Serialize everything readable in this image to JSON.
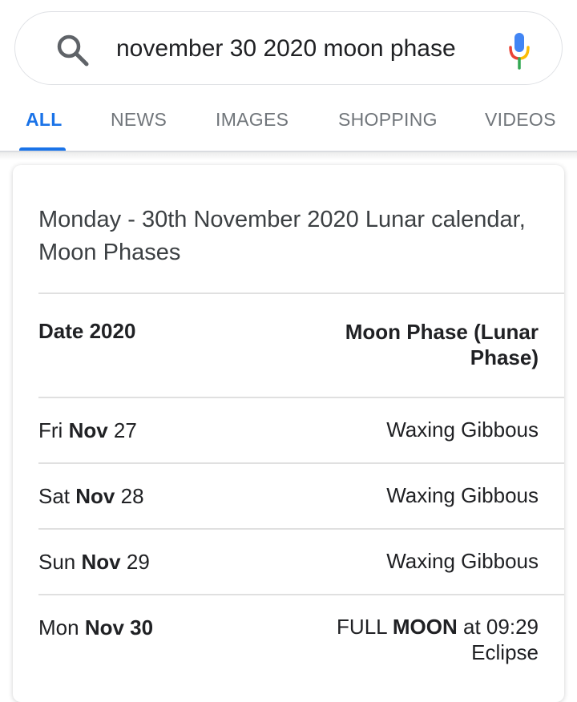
{
  "search": {
    "query": "november 30 2020 moon phase",
    "icon": "search-icon",
    "mic_icon": "mic-icon"
  },
  "tabs": [
    {
      "label": "ALL",
      "active": true
    },
    {
      "label": "NEWS",
      "active": false
    },
    {
      "label": "IMAGES",
      "active": false
    },
    {
      "label": "SHOPPING",
      "active": false
    },
    {
      "label": "VIDEOS",
      "active": false
    }
  ],
  "colors": {
    "accent": "#1a73e8",
    "tab_inactive": "#70757a",
    "text": "#202124"
  },
  "result": {
    "title": "Monday - 30th November 2020 Lunar calendar, Moon Phases",
    "table": {
      "headers": [
        "Date 2020",
        "Moon Phase (Lunar Phase)"
      ],
      "rows": [
        {
          "weekday": "Fri",
          "month": "Nov",
          "day": "27",
          "phase": "Waxing Gibbous"
        },
        {
          "weekday": "Sat",
          "month": "Nov",
          "day": "28",
          "phase": "Waxing Gibbous"
        },
        {
          "weekday": "Sun",
          "month": "Nov",
          "day": "29",
          "phase": "Waxing Gibbous"
        },
        {
          "weekday": "Mon",
          "month": "Nov",
          "day": "30",
          "phase_prefix": "FULL",
          "phase_bold": "MOON",
          "phase_suffix": "at 09:29",
          "phase_line2": "Eclipse"
        }
      ]
    }
  }
}
